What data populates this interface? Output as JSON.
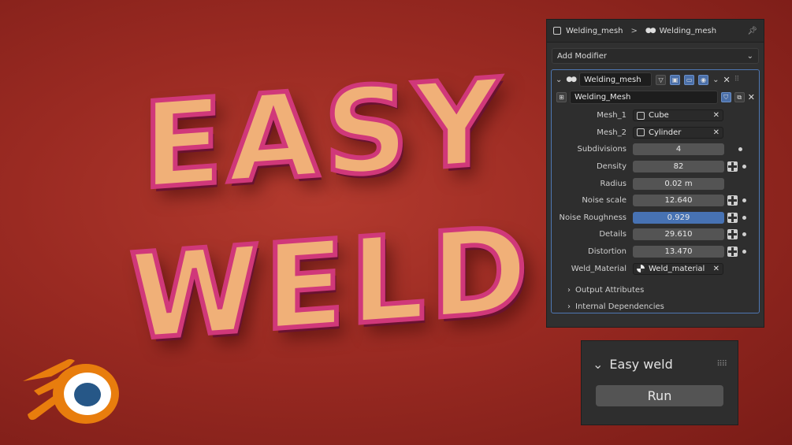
{
  "title_lines": [
    "EASY",
    "WELD"
  ],
  "breadcrumb": {
    "object_name": "Welding_mesh",
    "modifier_name": "Welding_mesh"
  },
  "add_modifier_label": "Add Modifier",
  "modifier": {
    "name": "Welding_mesh",
    "node_group": "Welding_Mesh",
    "properties": [
      {
        "label": "Mesh_1",
        "kind": "object",
        "value": "Cube"
      },
      {
        "label": "Mesh_2",
        "kind": "object",
        "value": "Cylinder"
      },
      {
        "label": "Subdivisions",
        "kind": "number",
        "value": "4"
      },
      {
        "label": "Density",
        "kind": "number",
        "value": "82"
      },
      {
        "label": "Radius",
        "kind": "number",
        "value": "0.02 m"
      },
      {
        "label": "Noise scale",
        "kind": "number",
        "value": "12.640"
      },
      {
        "label": "Noise Roughness",
        "kind": "number",
        "value": "0.929"
      },
      {
        "label": "Details",
        "kind": "number",
        "value": "29.610"
      },
      {
        "label": "Distortion",
        "kind": "number",
        "value": "13.470"
      },
      {
        "label": "Weld_Material",
        "kind": "material",
        "value": "Weld_material"
      }
    ],
    "subpanels": [
      "Output Attributes",
      "Internal Dependencies"
    ]
  },
  "easy_weld": {
    "title": "Easy weld",
    "run_label": "Run"
  },
  "colors": {
    "accent": "#4772b3",
    "panel_bg": "#303030",
    "title_fill": "#f0b078",
    "title_edge": "#d0387a",
    "logo_orange": "#e87d0d",
    "logo_blue": "#265787"
  }
}
